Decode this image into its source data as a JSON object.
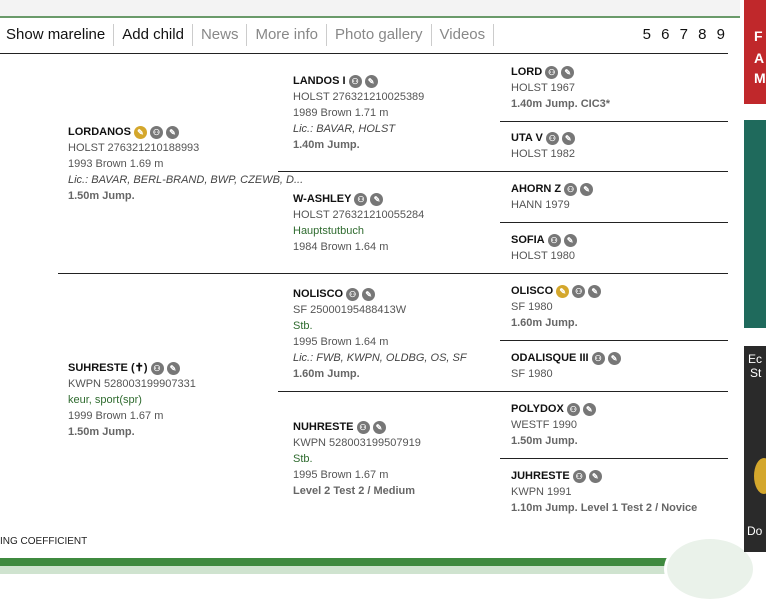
{
  "tabs": [
    "Show mareline",
    "Add child",
    "News",
    "More info",
    "Photo gallery",
    "Videos"
  ],
  "pagination": "5 6 7 8 9",
  "footer_text": "ING COEFFICIENT",
  "side_ads": {
    "ad1": [
      "F",
      "A",
      "M"
    ],
    "ad3": [
      "Ec",
      "St",
      "Do"
    ]
  },
  "pedigree": {
    "lordanos": {
      "name": "LORDANOS",
      "reg": "HOLST 276321210188993",
      "info": "1993 Brown 1.69 m",
      "lic": "Lic.: BAVAR, BERL-BRAND, BWP, CZEWB, D...",
      "sport": "1.50m Jump."
    },
    "suhreste": {
      "name": "SUHRESTE (✝)",
      "reg": "KWPN 528003199907331",
      "studbook": "keur, sport(spr)",
      "info": "1999 Brown 1.67 m",
      "sport": "1.50m Jump."
    },
    "landos": {
      "name": "LANDOS I",
      "reg": "HOLST 276321210025389",
      "info": "1989 Brown 1.71 m",
      "lic": "Lic.: BAVAR, HOLST",
      "sport": "1.40m Jump."
    },
    "washley": {
      "name": "W-ASHLEY",
      "reg": "HOLST 276321210055284",
      "studbook": "Hauptstutbuch",
      "info": "1984 Brown 1.64 m"
    },
    "nolisco": {
      "name": "NOLISCO",
      "reg": "SF 25000195488413W",
      "studbook": "Stb.",
      "info": "1995 Brown 1.64 m",
      "lic": "Lic.: FWB, KWPN, OLDBG, OS, SF",
      "sport": "1.60m Jump."
    },
    "nuhreste": {
      "name": "NUHRESTE",
      "reg": "KWPN 528003199507919",
      "studbook": "Stb.",
      "info": "1995 Brown 1.67 m",
      "sport": "Level 2 Test 2 / Medium"
    },
    "lord": {
      "name": "LORD",
      "reg": "HOLST 1967",
      "sport": "1.40m Jump. CIC3*"
    },
    "uta": {
      "name": "UTA V",
      "reg": "HOLST 1982"
    },
    "ahorn": {
      "name": "AHORN Z",
      "reg": "HANN 1979"
    },
    "sofia": {
      "name": "SOFIA",
      "reg": "HOLST 1980"
    },
    "olisco": {
      "name": "OLISCO",
      "reg": "SF 1980",
      "sport": "1.60m Jump."
    },
    "odalisque": {
      "name": "ODALISQUE III",
      "reg": "SF 1980"
    },
    "polydox": {
      "name": "POLYDOX",
      "reg": "WESTF 1990",
      "sport": "1.50m Jump."
    },
    "juhreste": {
      "name": "JUHRESTE",
      "reg": "KWPN 1991",
      "sport": "1.10m Jump. Level 1 Test 2 / Novice"
    }
  }
}
